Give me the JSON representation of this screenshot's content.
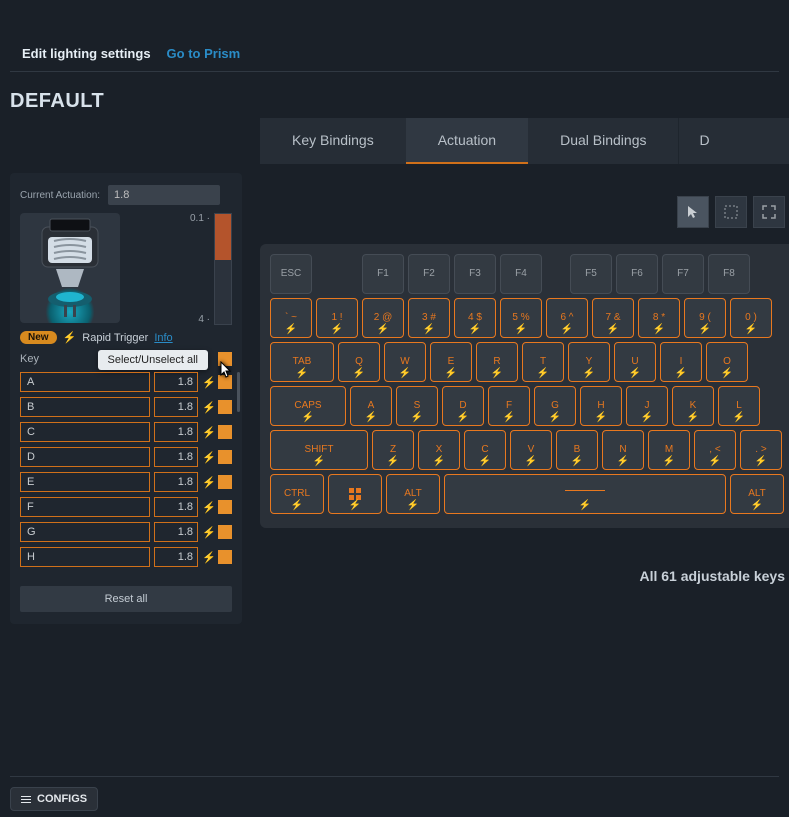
{
  "topbar": {
    "edit_label": "Edit lighting settings",
    "prism_link": "Go to Prism"
  },
  "section_title": "DEFAULT",
  "tabs": {
    "items": [
      "Key Bindings",
      "Actuation",
      "Dual Bindings",
      "D"
    ],
    "active_index": 1
  },
  "sidebar": {
    "current_label": "Current Actuation:",
    "current_value": "1.8",
    "scale_min": "0.1",
    "scale_max": "4",
    "new_badge": "New",
    "rapid_trigger": "Rapid Trigger",
    "info": "Info",
    "key_label": "Key",
    "tooltip": "Select/Unselect all",
    "keys": [
      {
        "name": "A",
        "value": "1.8"
      },
      {
        "name": "B",
        "value": "1.8"
      },
      {
        "name": "C",
        "value": "1.8"
      },
      {
        "name": "D",
        "value": "1.8"
      },
      {
        "name": "E",
        "value": "1.8"
      },
      {
        "name": "F",
        "value": "1.8"
      },
      {
        "name": "G",
        "value": "1.8"
      },
      {
        "name": "H",
        "value": "1.8"
      }
    ],
    "reset": "Reset all"
  },
  "keyboard": {
    "row_fn": [
      "ESC",
      "F1",
      "F2",
      "F3",
      "F4",
      "F5",
      "F6",
      "F7",
      "F8"
    ],
    "row_num": [
      {
        "t": "` ~",
        "b": "⚡"
      },
      {
        "t": "1 !",
        "b": "⚡"
      },
      {
        "t": "2 @",
        "b": "⚡"
      },
      {
        "t": "3 #",
        "b": "⚡"
      },
      {
        "t": "4 $",
        "b": "⚡"
      },
      {
        "t": "5 %",
        "b": "⚡"
      },
      {
        "t": "6 ^",
        "b": "⚡"
      },
      {
        "t": "7 &",
        "b": "⚡"
      },
      {
        "t": "8 *",
        "b": "⚡"
      },
      {
        "t": "9 (",
        "b": "⚡"
      },
      {
        "t": "0 )",
        "b": "⚡"
      }
    ],
    "row_q": [
      "TAB",
      "Q",
      "W",
      "E",
      "R",
      "T",
      "Y",
      "U",
      "I",
      "O"
    ],
    "row_a": [
      "CAPS",
      "A",
      "S",
      "D",
      "F",
      "G",
      "H",
      "J",
      "K",
      "L"
    ],
    "row_z": [
      "SHIFT",
      "Z",
      "X",
      "C",
      "V",
      "B",
      "N",
      "M",
      ", <",
      ". >"
    ],
    "row_bot": [
      "CTRL",
      "WIN",
      "ALT",
      "SPACE",
      "ALT"
    ]
  },
  "footer_note": "All 61 adjustable keys",
  "configs_btn": "CONFIGS"
}
